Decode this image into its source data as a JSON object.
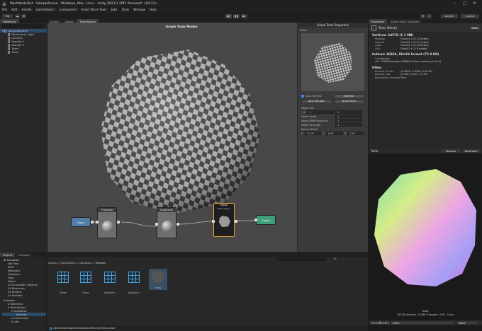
{
  "title": "MeshNodeTest - SampleScene - Windows, Mac, Linux - Unity 2023.2.20f1 Personal* <DX11>",
  "menu": [
    "File",
    "Edit",
    "Assets",
    "GameObject",
    "Component",
    "Asset Store Tools",
    "Jobs",
    "Tools",
    "Window",
    "Help"
  ],
  "toolbar": {
    "account": "RB",
    "layers": "Layers",
    "layout": "Layout"
  },
  "hierarchy": {
    "tab": "Hierarchy",
    "items": [
      "SampleScene*",
      "Directional Light",
      "Camera",
      "Sample 1",
      "Sample 2",
      "Tests",
      "Tests"
    ]
  },
  "scene_tabs": [
    "Scene",
    "Game",
    "MeshNodes"
  ],
  "graph": {
    "title": "Graph Tools Nodes",
    "nodes": {
      "input": "Input",
      "primitive": "Primitive",
      "subdivide": "Subdivide",
      "noise": "Noise",
      "noise_sub": "MESH OBJECT",
      "output": "Output"
    }
  },
  "graph_props": {
    "title": "Graph Tools Properties",
    "preview_label": "Noise",
    "auto_refresh": "Auto Refresh",
    "refresh": "Refresh",
    "save_render": "Save Render",
    "build_mesh": "Build Mesh",
    "section": "Noise Cfg",
    "fields": [
      {
        "label": "X",
        "a": "-1",
        "b": "1"
      },
      {
        "label": "Noise Scale",
        "v": "1"
      },
      {
        "label": "Noise FBM Iterations",
        "v": "1"
      },
      {
        "label": "Noise Strength",
        "v": "1"
      }
    ],
    "offset_label": "Noise Offset",
    "offset": [
      "11.01",
      "5.97",
      "1.03"
    ]
  },
  "inspector": {
    "tabs": [
      "Inspector",
      "Asset Store Uploader"
    ],
    "object": "Tests (Mesh)",
    "open": "Open",
    "vertices_header": "Vertices: 24578 (1.1 MB)",
    "attrs": [
      {
        "k": "Position",
        "v": "Float32 x 3 (12 bytes)"
      },
      {
        "k": "Normal",
        "v": "Float32 x 3 (12 bytes)"
      },
      {
        "k": "Color",
        "v": "Float32 x 4 (16 bytes)"
      },
      {
        "k": "UV0",
        "v": "Float32 x 2 (8 bytes)"
      }
    ],
    "indices_header": "Indices: 36864, UInt16 format (72.0 KB)",
    "indices": [
      "1 submesh:",
      "#0: 12288 triangles (36864 indices starting from 0)"
    ],
    "other_header": "Other",
    "other": [
      {
        "k": "Bounds Center",
        "v": "(0.4431, 0.4453, 0.4574)"
      },
      {
        "k": "Bounds Size",
        "v": "(2.196, 2.203, 2.119)"
      },
      {
        "k": "Read/Write Enabled",
        "v": "True"
      }
    ]
  },
  "preview": {
    "tab": "Tests",
    "mode": "Normals",
    "wire": "Wireframe",
    "caption1": "Tests",
    "caption2": "24578 Vertices, 12288 Triangles | UV1, Color"
  },
  "bottom": {
    "tabs": [
      "Project",
      "Console"
    ],
    "favorites": [
      "Vat Test",
      "MVP",
      "Neweditr",
      "Skeleton",
      "Tops",
      "Tower",
      "All Scriptable Objects",
      "All Materials",
      "All Models",
      "All Prefabs"
    ],
    "assets_tree": [
      "Assets",
      "Materials",
      "MeshNodes",
      "Database",
      "Meshes",
      "Extensions",
      "Jobs"
    ],
    "breadcrumb": [
      "Assets",
      "MeshNodes",
      "Database",
      "Meshes"
    ],
    "assets": [
      "Noise",
      "Plane",
      "Sample 1",
      "Sample 2",
      "Tests"
    ],
    "status": "Assets/MeshNodes/Database/Meshes/Tests.asset",
    "count": "14"
  },
  "asset_labels": {
    "label": "AssetBundle",
    "value": "None",
    "value2": "None"
  }
}
